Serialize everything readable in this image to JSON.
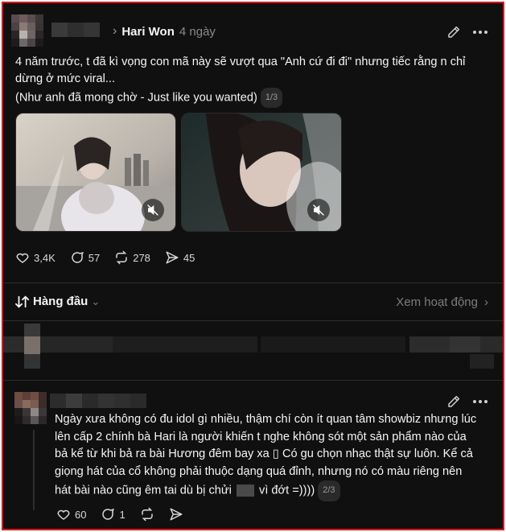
{
  "post": {
    "author": "Hari Won",
    "time": "4 ngày",
    "text_line1": "4 năm trước, t đã kì vọng con mã này sẽ vượt qua \"Anh cứ đi đi\" nhưng tiếc rằng n chỉ",
    "text_line2": "dừng ở mức viral...",
    "text_line3": "(Như anh đã mong chờ - Just like you wanted)",
    "counter": "1/3",
    "likes": "3,4K",
    "comments": "57",
    "reposts": "278",
    "shares": "45"
  },
  "sort_bar": {
    "label": "Hàng đầu",
    "activity": "Xem hoạt động"
  },
  "reply": {
    "text_line1": "Ngày xưa không có đu idol gì nhiều, thậm chí còn ít quan tâm showbiz nhưng lúc",
    "text_line2": "lên cấp 2 chính bà Hari là người khiến t nghe không sót một sản phẩm nào của",
    "text_line3": "bả kể từ khi bả ra bài Hương đêm bay xa",
    "text_line3_glyph": "▯",
    "text_line3_tail": "Có gu chọn nhạc thật sự luôn. Kể cả",
    "text_line4": "giọng hát của cổ không phải thuộc dạng quá đỉnh, nhưng nó có màu riêng nên",
    "text_line5_a": "hát bài nào cũng êm tai dù bị chửi",
    "text_line5_b": "vì đớt =))))",
    "counter": "2/3",
    "likes": "60",
    "comments": "1"
  },
  "colors": {
    "background": "#101010",
    "border": "#d9161c",
    "text": "#f3f5f7",
    "muted": "#8a8a8a"
  }
}
